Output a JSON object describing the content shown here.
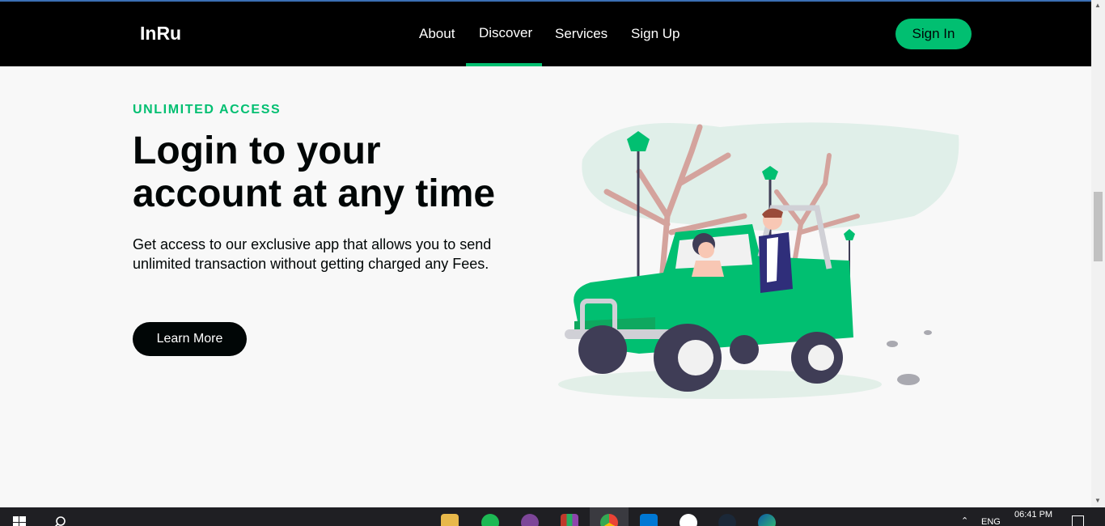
{
  "nav": {
    "brand": "InRu",
    "links": [
      "About",
      "Discover",
      "Services",
      "Sign Up"
    ],
    "active": "Discover",
    "signin_label": "Sign In"
  },
  "hero": {
    "topline": "UNLIMITED ACCESS",
    "heading": "Login to your account at any time",
    "subtitle": "Get access to our exclusive app that allows you to send unlimited transaction without getting charged any Fees.",
    "button_label": "Learn More"
  },
  "colors": {
    "accent": "#01bf71",
    "nav_bg": "#000000",
    "page_bg": "#f8f8f8",
    "text_dark": "#010606"
  },
  "taskbar": {
    "lang": "ENG",
    "time": "06:41 PM",
    "apps": [
      "file-explorer-icon",
      "spotify-icon",
      "tor-browser-icon",
      "winrar-icon",
      "chrome-icon",
      "vscode-icon",
      "docs-icon",
      "steam-icon",
      "edge-icon"
    ]
  }
}
